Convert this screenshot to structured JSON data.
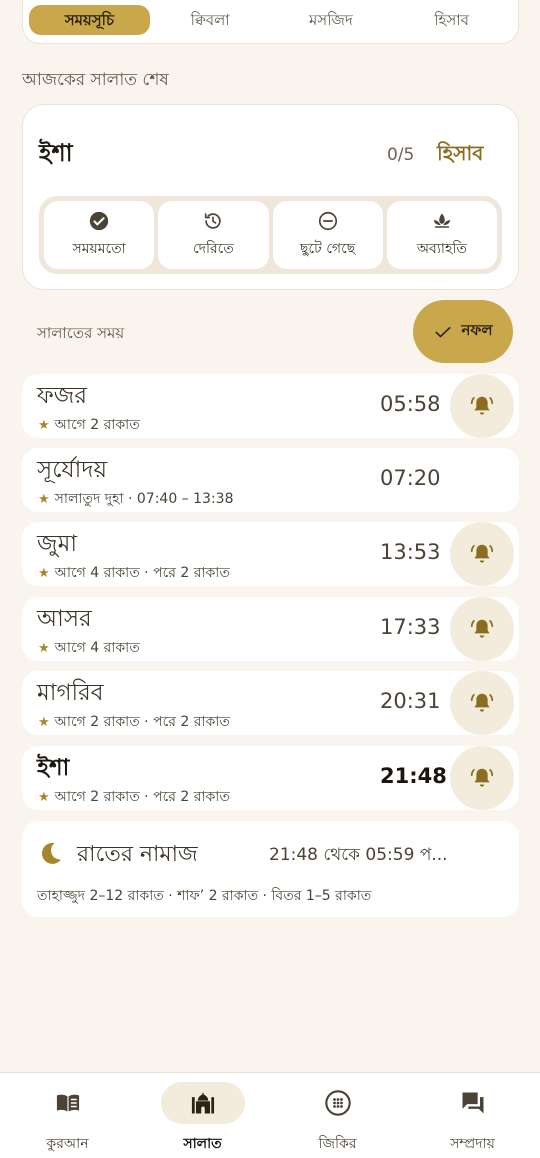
{
  "colors": {
    "accent": "#c9a84c",
    "accent_dark": "#8a6d1f",
    "icon": "#6a5a3a",
    "background": "#f9f5ee"
  },
  "top_tabs": [
    {
      "label": "সময়সূচি",
      "active": true
    },
    {
      "label": "ক্বিবলা"
    },
    {
      "label": "মসজিদ"
    },
    {
      "label": "হিসাব"
    }
  ],
  "status": {
    "section_label": "আজকের সালাত শেষ",
    "title": "ইশা",
    "count": "0/5",
    "link": "হিসাব",
    "options": [
      {
        "icon": "check-circle-icon",
        "label": "সময়মতো"
      },
      {
        "icon": "history-icon",
        "label": "দেরিতে"
      },
      {
        "icon": "minus-circle-icon",
        "label": "ছুটে গেছে"
      },
      {
        "icon": "lotus-icon",
        "label": "অব্যাহতি"
      }
    ]
  },
  "times": {
    "label": "সালাতের সময়",
    "nafl_label": "নফল"
  },
  "prayers": [
    {
      "name": "ফজর",
      "sub": "আগে 2 রাকাত",
      "time": "05:58",
      "bell": true
    },
    {
      "name": "সূর্যোদয়",
      "sub": "সালাতুদ দুহা · 07:40 – 13:38",
      "time": "07:20",
      "bell": false
    },
    {
      "name": "জুমা",
      "sub": "আগে 4 রাকাত · পরে 2 রাকাত",
      "time": "13:53",
      "bell": true
    },
    {
      "name": "আসর",
      "sub": "আগে 4 রাকাত",
      "time": "17:33",
      "bell": true
    },
    {
      "name": "মাগরিব",
      "sub": "আগে 2 রাকাত · পরে 2 রাকাত",
      "time": "20:31",
      "bell": true
    },
    {
      "name": "ইশা",
      "sub": "আগে 2 রাকাত · পরে 2 রাকাত",
      "time": "21:48",
      "bell": true,
      "current": true
    }
  ],
  "night": {
    "title": "রাতের নামাজ",
    "time": "21:48 থেকে 05:59 প...",
    "sub": "তাহাজ্জুদ 2–12 রাকাত · শাফ’ 2 রাকাত · বিতর 1–5 রাকাত"
  },
  "bottom_nav": [
    {
      "label": "কুরআন",
      "icon": "book-icon"
    },
    {
      "label": "সালাত",
      "icon": "mosque-icon",
      "active": true
    },
    {
      "label": "জিকির",
      "icon": "tasbih-icon"
    },
    {
      "label": "সম্প্রদায়",
      "icon": "forum-icon"
    }
  ]
}
